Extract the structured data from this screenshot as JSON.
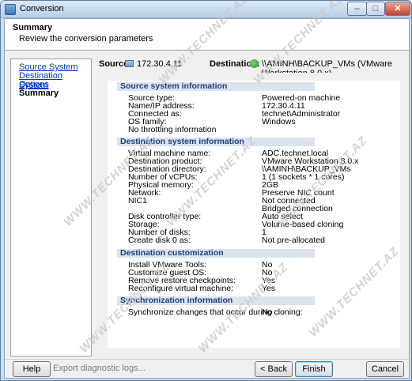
{
  "window": {
    "title": "Conversion",
    "controls": {
      "minimize": "–",
      "maximize": "□",
      "close": "✕"
    }
  },
  "header": {
    "title": "Summary",
    "subtitle": "Review the conversion parameters"
  },
  "nav": {
    "items": [
      {
        "label": "Source System",
        "current": false
      },
      {
        "label": "Destination System",
        "current": false
      },
      {
        "label": "Options",
        "current": false
      },
      {
        "label": "Summary",
        "current": true
      }
    ]
  },
  "source": {
    "label": "Source:",
    "value": "172.30.4.11",
    "icon": "computer-icon"
  },
  "destination": {
    "label": "Destination:",
    "value": "\\\\AMINH\\BACKUP_VMs (VMware Workstation 8.0.x)",
    "icon": "vmware-icon"
  },
  "sections": [
    {
      "title": "Source system information",
      "rows": [
        {
          "label": "Source type:",
          "value": "Powered-on machine"
        },
        {
          "label": "Name/IP address:",
          "value": "172.30.4.11"
        },
        {
          "label": "Connected as:",
          "value": "technet\\Administrator"
        },
        {
          "label": "OS family:",
          "value": "Windows"
        },
        {
          "label": "No throttling information",
          "value": ""
        }
      ]
    },
    {
      "title": "Destination system information",
      "rows": [
        {
          "label": "Virtual machine name:",
          "value": "ADC.technet.local"
        },
        {
          "label": "Destination product:",
          "value": "VMware Workstation 8.0.x"
        },
        {
          "label": "Destination directory:",
          "value": "\\\\AMINH\\BACKUP_VMs"
        },
        {
          "label": "Number of vCPUs:",
          "value": "1 (1 sockets * 1 cores)"
        },
        {
          "label": "Physical memory:",
          "value": "2GB"
        },
        {
          "label": "Network:",
          "value": "Preserve NIC count"
        },
        {
          "label": "NIC1",
          "value": "Not connected"
        },
        {
          "label": "",
          "value": "Bridged connection"
        },
        {
          "label": "Disk controller type:",
          "value": "Auto select"
        },
        {
          "label": "Storage:",
          "value": "Volume-based cloning"
        },
        {
          "label": "Number of disks:",
          "value": "1"
        },
        {
          "label": "Create disk 0 as:",
          "value": "Not pre-allocated"
        }
      ]
    },
    {
      "title": "Destination customization",
      "rows": [
        {
          "label": "Install VMware Tools:",
          "value": "No"
        },
        {
          "label": "Customize guest OS:",
          "value": "No"
        },
        {
          "label": "Remove restore checkpoints:",
          "value": "Yes"
        },
        {
          "label": "Reconfigure virtual machine:",
          "value": "Yes"
        }
      ]
    },
    {
      "title": "Synchronization information",
      "rows": [
        {
          "label": "Synchronize changes that occur during cloning:",
          "value": "No"
        }
      ]
    }
  ],
  "footer": {
    "help": "Help",
    "export": "Export diagnostic logs...",
    "back": "< Back",
    "finish": "Finish",
    "cancel": "Cancel"
  },
  "watermark": "WWW.TECHNET.AZ"
}
